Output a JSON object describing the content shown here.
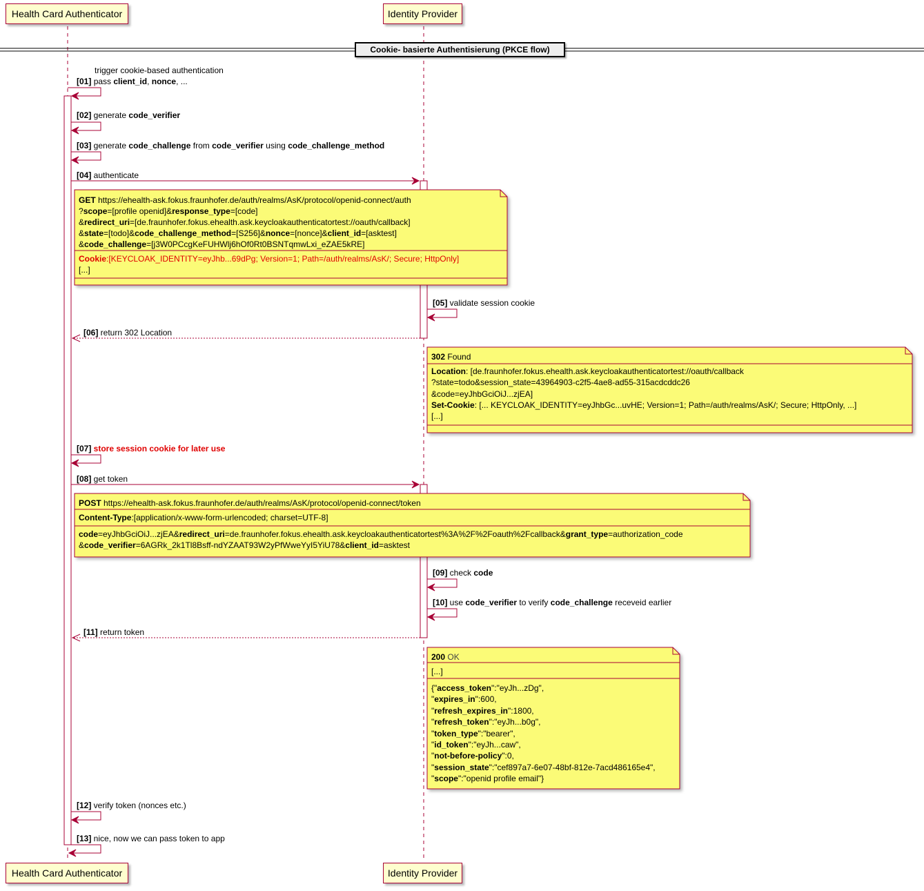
{
  "participants": {
    "hca": "Health Card Authenticator",
    "idp": "Identity Provider"
  },
  "divider": "Cookie- basierte Authentisierung (PKCE flow)",
  "messages": {
    "m01": {
      "num": "[01]",
      "line1": "trigger cookie-based authentication",
      "pass": "pass ",
      "client_id": "client_id",
      "comma1": ", ",
      "nonce": "nonce",
      "rest": ", ..."
    },
    "m02": {
      "num": "[02]",
      "pre": " generate ",
      "b1": "code_verifier"
    },
    "m03": {
      "num": "[03]",
      "pre": " generate ",
      "b1": "code_challenge",
      "mid1": " from ",
      "b2": "code_verifier",
      "mid2": " using ",
      "b3": "code_challenge_method"
    },
    "m04": {
      "num": "[04]",
      "text": " authenticate"
    },
    "m05": {
      "num": "[05]",
      "text": " validate session cookie"
    },
    "m06": {
      "num": "[06]",
      "text": " return 302 Location"
    },
    "m07": {
      "num": "[07]",
      "text": " store session cookie for later use"
    },
    "m08": {
      "num": "[08]",
      "text": " get token"
    },
    "m09": {
      "num": "[09]",
      "pre": " check ",
      "b1": "code"
    },
    "m10": {
      "num": "[10]",
      "pre": " use ",
      "b1": "code_verifier",
      "mid": " to verify ",
      "b2": "code_challenge",
      "post": " receveid earlier"
    },
    "m11": {
      "num": "[11]",
      "text": " return token"
    },
    "m12": {
      "num": "[12]",
      "text": " verify token (nonces etc.)"
    },
    "m13": {
      "num": "[13]",
      "text": " nice, now we can pass token to app"
    }
  },
  "note1": {
    "get": "GET",
    "url": " https://ehealth-ask.fokus.fraunhofer.de/auth/realms/AsK/protocol/openid-connect/auth",
    "l2a": "?",
    "scope": "scope",
    "l2b": "=[profile openid]&",
    "response_type": "response_type",
    "l2c": "=[code]",
    "l3a": "&",
    "redirect_uri": "redirect_uri",
    "l3b": "=[de.fraunhofer.fokus.ehealth.ask.keycloakauthenticatortest://oauth/callback]",
    "l4a": "&",
    "state": "state",
    "l4b": "=[todo]&",
    "code_challenge_method": "code_challenge_method",
    "l4c": "=[S256]&",
    "nonce": "nonce",
    "l4d": "=[nonce]&",
    "client_id": "client_id",
    "l4e": "=[asktest]",
    "l5a": "&",
    "code_challenge": "code_challenge",
    "l5b": "=[j3W0PCcgKeFUHWlj6hOf0Rt0BSNTqmwLxi_eZAE5kRE]",
    "cookie": "Cookie",
    "cookie_val": ":[KEYCLOAK_IDENTITY=eyJhb...69dPg; Version=1; Path=/auth/realms/AsK/; Secure; HttpOnly]",
    "ellipsis": "[...]"
  },
  "note2": {
    "status": "302",
    "status_text": " Found",
    "location": "Location",
    "loc_val": ": [de.fraunhofer.fokus.ehealth.ask.keycloakauthenticatortest://oauth/callback",
    "loc2": "?state=todo&session_state=43964903-c2f5-4ae8-ad55-315acdcddc26",
    "loc3": "&code=eyJhbGciOiJ...zjEA]",
    "set_cookie": "Set-Cookie",
    "set_cookie_val": ": [... KEYCLOAK_IDENTITY=eyJhbGc...uvHE; Version=1; Path=/auth/realms/AsK/; Secure; HttpOnly, ...]",
    "ellipsis": "[...]"
  },
  "note3": {
    "post": "POST",
    "url": " https://ehealth-ask.fokus.fraunhofer.de/auth/realms/AsK/protocol/openid-connect/token",
    "ct": "Content-Type",
    "ct_val": ":[application/x-www-form-urlencoded; charset=UTF-8]",
    "code": "code",
    "l1b": "=eyJhbGciOiJ...zjEA&",
    "redirect_uri": "redirect_uri",
    "l1c": "=de.fraunhofer.fokus.ehealth.ask.keycloakauthenticatortest%3A%2F%2Foauth%2Fcallback&",
    "grant_type": "grant_type",
    "l1d": "=authorization_code",
    "l2a": "&",
    "code_verifier": "code_verifier",
    "l2b": "=6AGRk_2k1Tl8Bsff-ndYZAAT93W2yPfWweYyI5YiU78&",
    "client_id": "client_id",
    "l2c": "=asktest"
  },
  "note4": {
    "status": "200",
    "status_text": " OK",
    "ellipsis": "[...]",
    "rows": [
      {
        "pre": "{\"",
        "key": "access_token",
        "post": "\":\"eyJh...zDg\","
      },
      {
        "pre": "\"",
        "key": "expires_in",
        "post": "\":600,"
      },
      {
        "pre": "\"",
        "key": "refresh_expires_in",
        "post": "\":1800,"
      },
      {
        "pre": "\"",
        "key": "refresh_token",
        "post": "\":\"eyJh...b0g\","
      },
      {
        "pre": "\"",
        "key": "token_type",
        "post": "\":\"bearer\","
      },
      {
        "pre": "\"",
        "key": "id_token",
        "post": "\":\"eyJh...caw\","
      },
      {
        "pre": "\"",
        "key": "not-before-policy",
        "post": "\":0,"
      },
      {
        "pre": "\"",
        "key": "session_state",
        "post": "\":\"cef897a7-6e07-48bf-812e-7acd486165e4\","
      },
      {
        "pre": "\"",
        "key": "scope",
        "post": "\":\"openid profile email\"}"
      }
    ]
  },
  "colors": {
    "arrow": "#A80036",
    "participant_bg": "#FEFECE",
    "note_bg": "#FBFB77",
    "activation_bg": "#FFFFFF",
    "highlight": "#E00000"
  }
}
